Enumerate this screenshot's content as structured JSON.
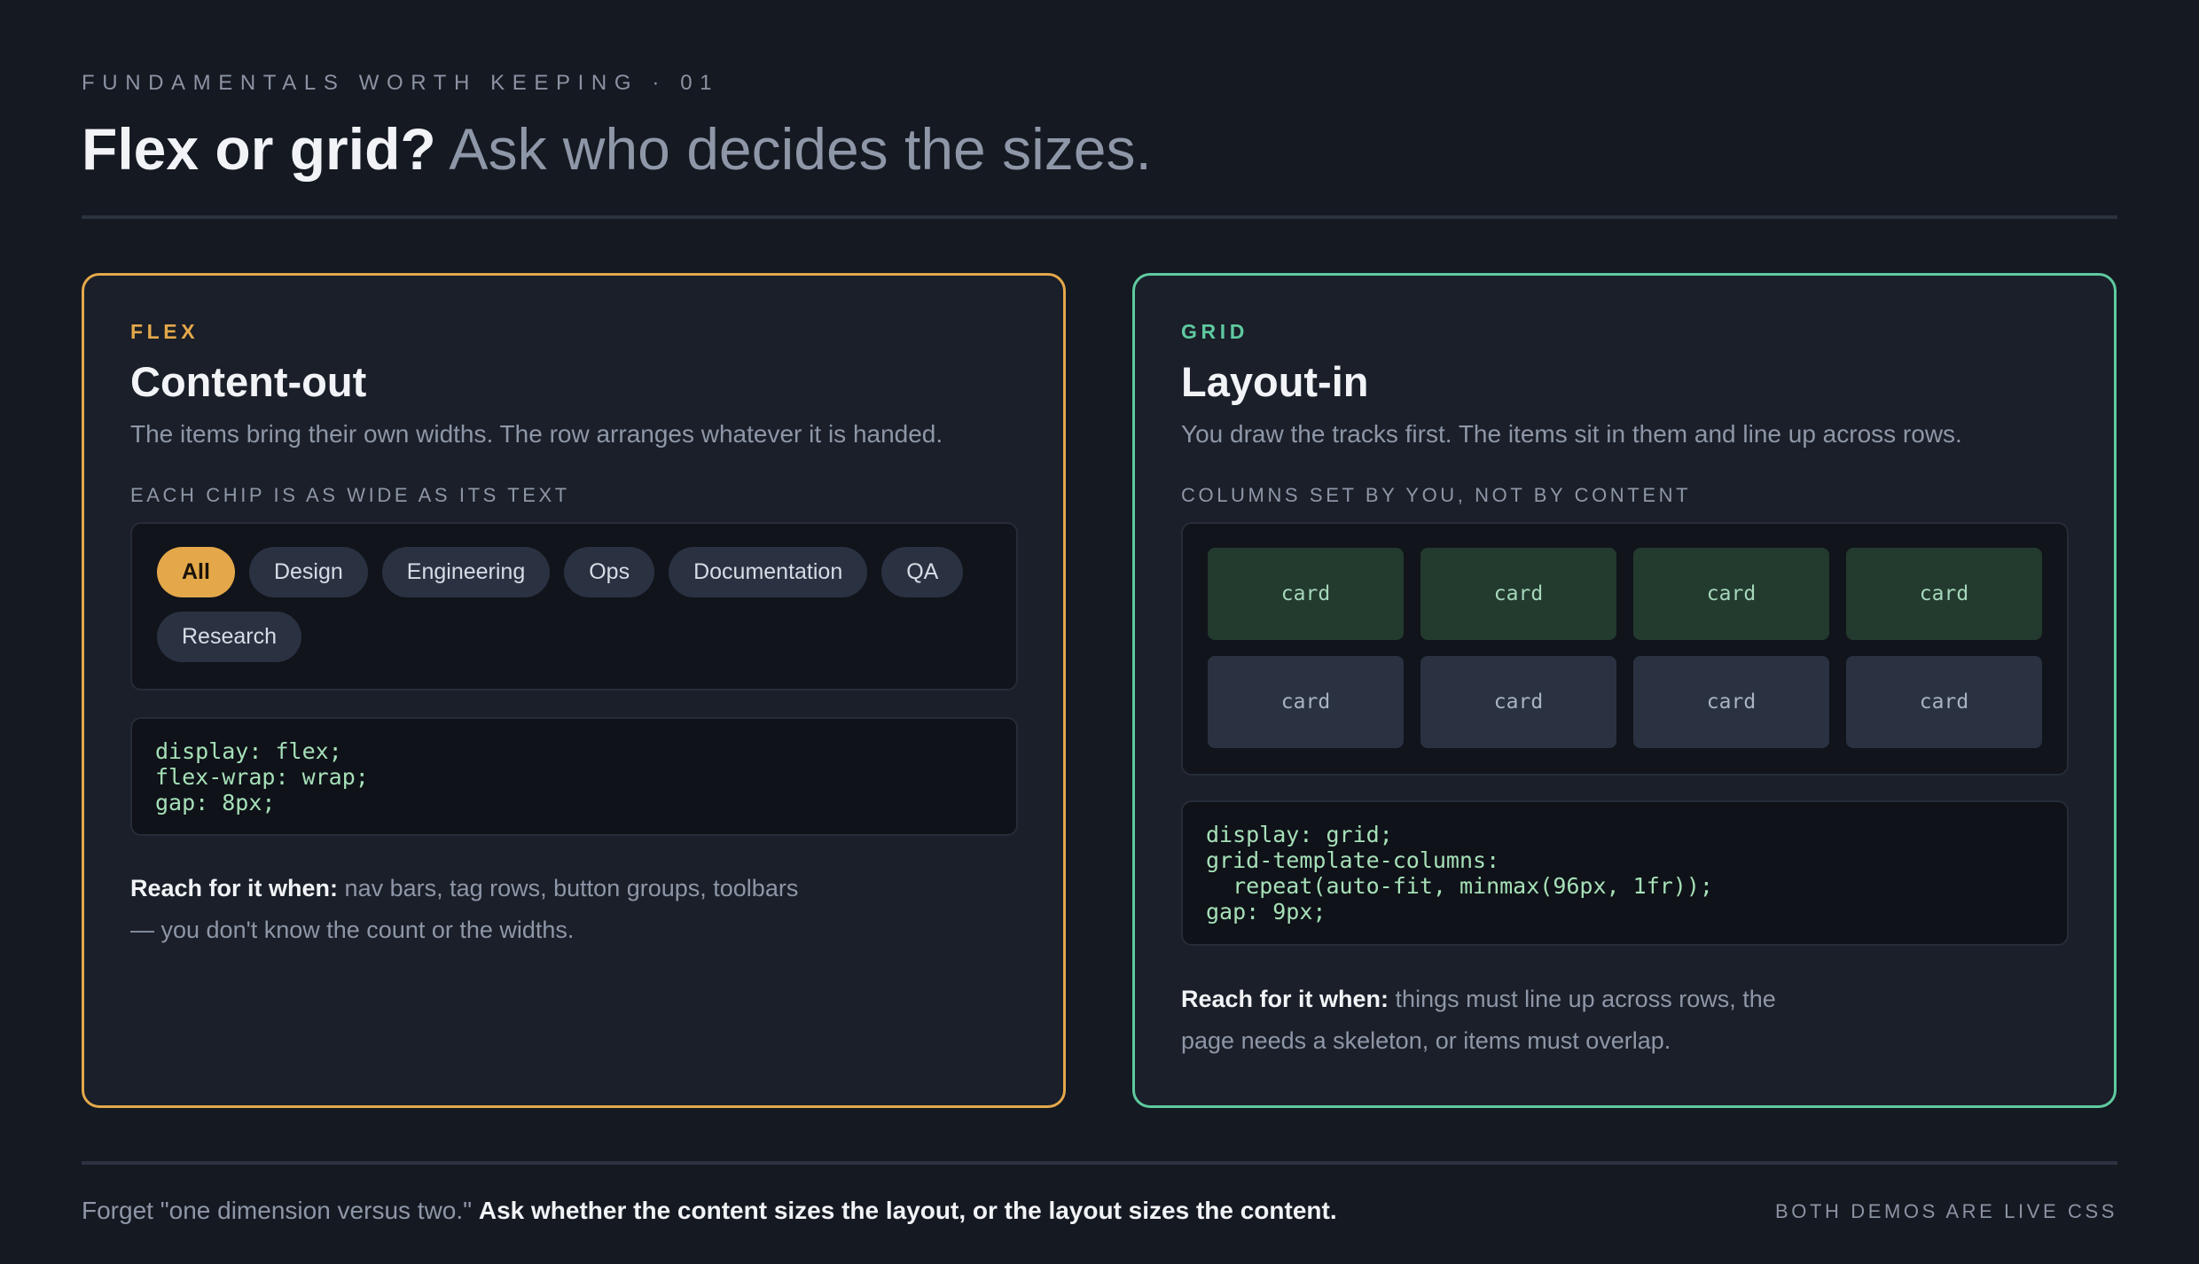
{
  "eyebrow": "FUNDAMENTALS WORTH KEEPING · 01",
  "headline": {
    "bold": "Flex or grid?",
    "light": "Ask who decides the sizes."
  },
  "colors": {
    "flex_accent": "#e4a84a",
    "grid_accent": "#5fcaa0",
    "background": "#151922"
  },
  "flex": {
    "tag": "FLEX",
    "title": "Content-out",
    "description": "The items bring their own widths. The row arranges whatever it is handed.",
    "demo_label": "EACH CHIP IS AS WIDE AS ITS TEXT",
    "chips": [
      "All",
      "Design",
      "Engineering",
      "Ops",
      "Documentation",
      "QA",
      "Research"
    ],
    "active_chip": "All",
    "code": "display: flex;\nflex-wrap: wrap;\ngap: 8px;",
    "reach_label": "Reach for it when:",
    "reach_text": "nav bars, tag rows, button groups, toolbars — you don't know the count or the widths."
  },
  "grid": {
    "tag": "GRID",
    "title": "Layout-in",
    "description": "You draw the tracks first. The items sit in them and line up across rows.",
    "demo_label": "COLUMNS SET BY YOU, NOT BY CONTENT",
    "cells": [
      "card",
      "card",
      "card",
      "card",
      "card",
      "card",
      "card",
      "card"
    ],
    "code": "display: grid;\ngrid-template-columns:\n  repeat(auto-fit, minmax(96px, 1fr));\ngap: 9px;",
    "reach_label": "Reach for it when:",
    "reach_text": "things must line up across rows, the page needs a skeleton, or items must overlap."
  },
  "footer": {
    "lead": "Forget \"one dimension versus two.\"",
    "emphasis": "Ask whether the content sizes the layout, or the layout sizes the content.",
    "note": "BOTH DEMOS ARE LIVE CSS"
  }
}
